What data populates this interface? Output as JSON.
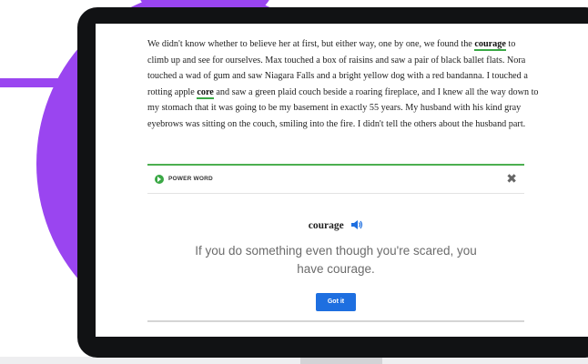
{
  "passage": {
    "p1": "We didn't know whether to believe her at first, but either way, one by one, we found the",
    "link1": "courage",
    "p2": " to climb up and see for ourselves. Max touched a box of raisins and saw a pair of black ballet flats. Nora touched a wad of gum and saw Niagara Falls and a bright yellow dog with a red bandanna. I touched a rotting apple ",
    "link2": "core",
    "p3": " and saw a green plaid couch beside a roaring fireplace, and I knew all the way down to my stomach that it was going to be my basement in exactly 55 years. My husband with his kind gray eyebrows was sitting on the couch, smiling into the fire. I didn't tell the others about the husband part."
  },
  "panel": {
    "header_label": "POWER WORD",
    "close_icon": "close-icon",
    "word": "courage",
    "speaker_icon": "speaker-icon",
    "definition": "If you do something even though you're scared, you have courage.",
    "button_label": "Got it"
  },
  "colors": {
    "accent_purple": "#9a45f0",
    "power_word_green": "#3aa845",
    "button_blue": "#1e6fe0"
  }
}
